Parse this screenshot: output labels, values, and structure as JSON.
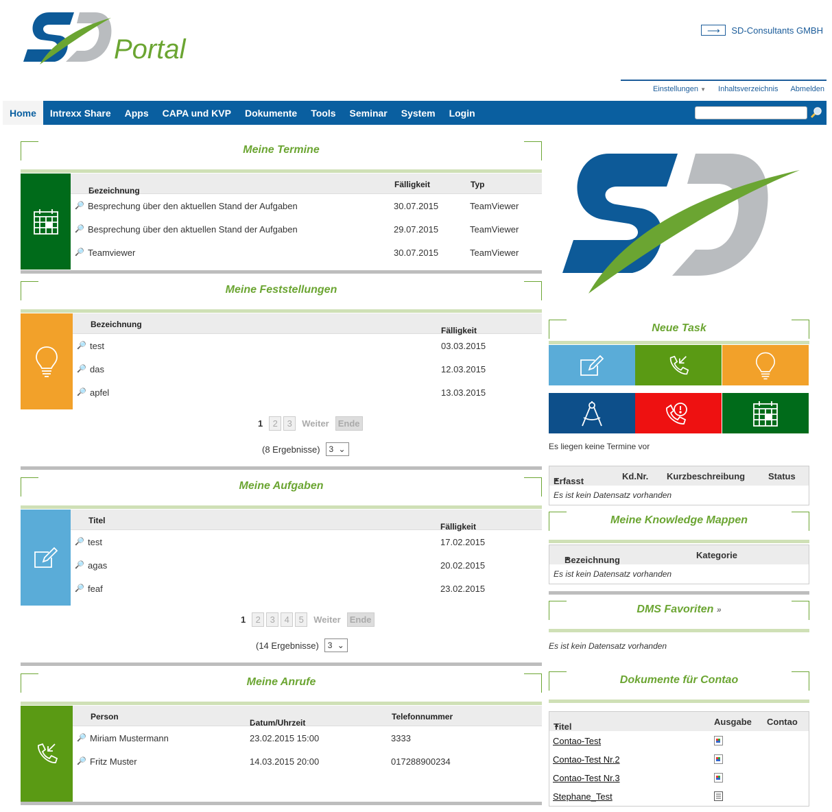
{
  "header": {
    "logo_text": "Portal",
    "company_link": "SD-Consultants GMBH",
    "util_links": [
      "Einstellungen",
      "Inhaltsverzeichnis",
      "Abmelden"
    ]
  },
  "nav": {
    "items": [
      "Home",
      "Intrexx Share",
      "Apps",
      "CAPA und KVP",
      "Dokumente",
      "Tools",
      "Seminar",
      "System",
      "Login"
    ],
    "search_placeholder": ""
  },
  "termine": {
    "title": "Meine Termine",
    "columns": [
      "Bezeichnung",
      "Fälligkeit",
      "Typ"
    ],
    "rows": [
      {
        "bez": "Besprechung über den aktuellen Stand der Aufgaben",
        "date": "30.07.2015",
        "typ": "TeamViewer"
      },
      {
        "bez": "Besprechung über den aktuellen Stand der Aufgaben",
        "date": "29.07.2015",
        "typ": "TeamViewer"
      },
      {
        "bez": "Teamviewer",
        "date": "30.07.2015",
        "typ": "TeamViewer"
      }
    ],
    "color": "#006b1a"
  },
  "feststellungen": {
    "title": "Meine Feststellungen",
    "columns": [
      "Bezeichnung",
      "Fälligkeit"
    ],
    "rows": [
      {
        "bez": "test",
        "date": "03.03.2015"
      },
      {
        "bez": "das",
        "date": "12.03.2015"
      },
      {
        "bez": "apfel",
        "date": "13.03.2015"
      }
    ],
    "pager": {
      "current": "1",
      "pages": [
        "2",
        "3"
      ],
      "next": "Weiter",
      "end": "Ende"
    },
    "results": "(8 Ergebnisse)",
    "per_page": "3",
    "color": "#f2a12a"
  },
  "aufgaben": {
    "title": "Meine Aufgaben",
    "columns": [
      "Titel",
      "Fälligkeit"
    ],
    "rows": [
      {
        "bez": "test",
        "date": "17.02.2015"
      },
      {
        "bez": "agas",
        "date": "20.02.2015"
      },
      {
        "bez": "feaf",
        "date": "23.02.2015"
      }
    ],
    "pager": {
      "current": "1",
      "pages": [
        "2",
        "3",
        "4",
        "5"
      ],
      "next": "Weiter",
      "end": "Ende"
    },
    "results": "(14 Ergebnisse)",
    "per_page": "3",
    "color": "#5aacd8"
  },
  "anrufe": {
    "title": "Meine Anrufe",
    "columns": [
      "Person",
      "Datum/Uhrzeit",
      "Telefonnummer"
    ],
    "rows": [
      {
        "person": "Miriam Mustermann",
        "date": "23.02.2015 15:00",
        "tel": "3333"
      },
      {
        "person": "Fritz Muster",
        "date": "14.03.2015 20:00",
        "tel": "017288900234"
      }
    ],
    "color": "#5a9a14"
  },
  "neue_task": {
    "title": "Neue Task",
    "tiles": [
      {
        "icon": "edit-icon",
        "color": "#5aacd8"
      },
      {
        "icon": "phone-incoming-icon",
        "color": "#5a9a14"
      },
      {
        "icon": "lightbulb-icon",
        "color": "#f2a12a"
      },
      {
        "icon": "compass-icon",
        "color": "#0d4f8a"
      },
      {
        "icon": "phone-alert-icon",
        "color": "#ee1111"
      },
      {
        "icon": "calendar-icon",
        "color": "#006b1a"
      }
    ],
    "note": "Es liegen keine Termine vor",
    "table_columns": [
      "Erfasst",
      "Kd.Nr.",
      "Kurzbeschreibung",
      "Status"
    ],
    "empty": "Es ist kein Datensatz vorhanden"
  },
  "knowledge": {
    "title": "Meine Knowledge Mappen",
    "columns": [
      "Bezeichnung",
      "Kategorie"
    ],
    "empty": "Es ist kein Datensatz vorhanden"
  },
  "dms": {
    "title": "DMS Favoriten",
    "empty": "Es ist kein Datensatz vorhanden"
  },
  "contao": {
    "title": "Dokumente für Contao",
    "columns": [
      "Titel",
      "Ausgabe",
      "Contao"
    ],
    "rows": [
      "Contao-Test",
      "Contao-Test Nr.2",
      "Contao-Test Nr.3",
      "Stephane_Test"
    ]
  }
}
